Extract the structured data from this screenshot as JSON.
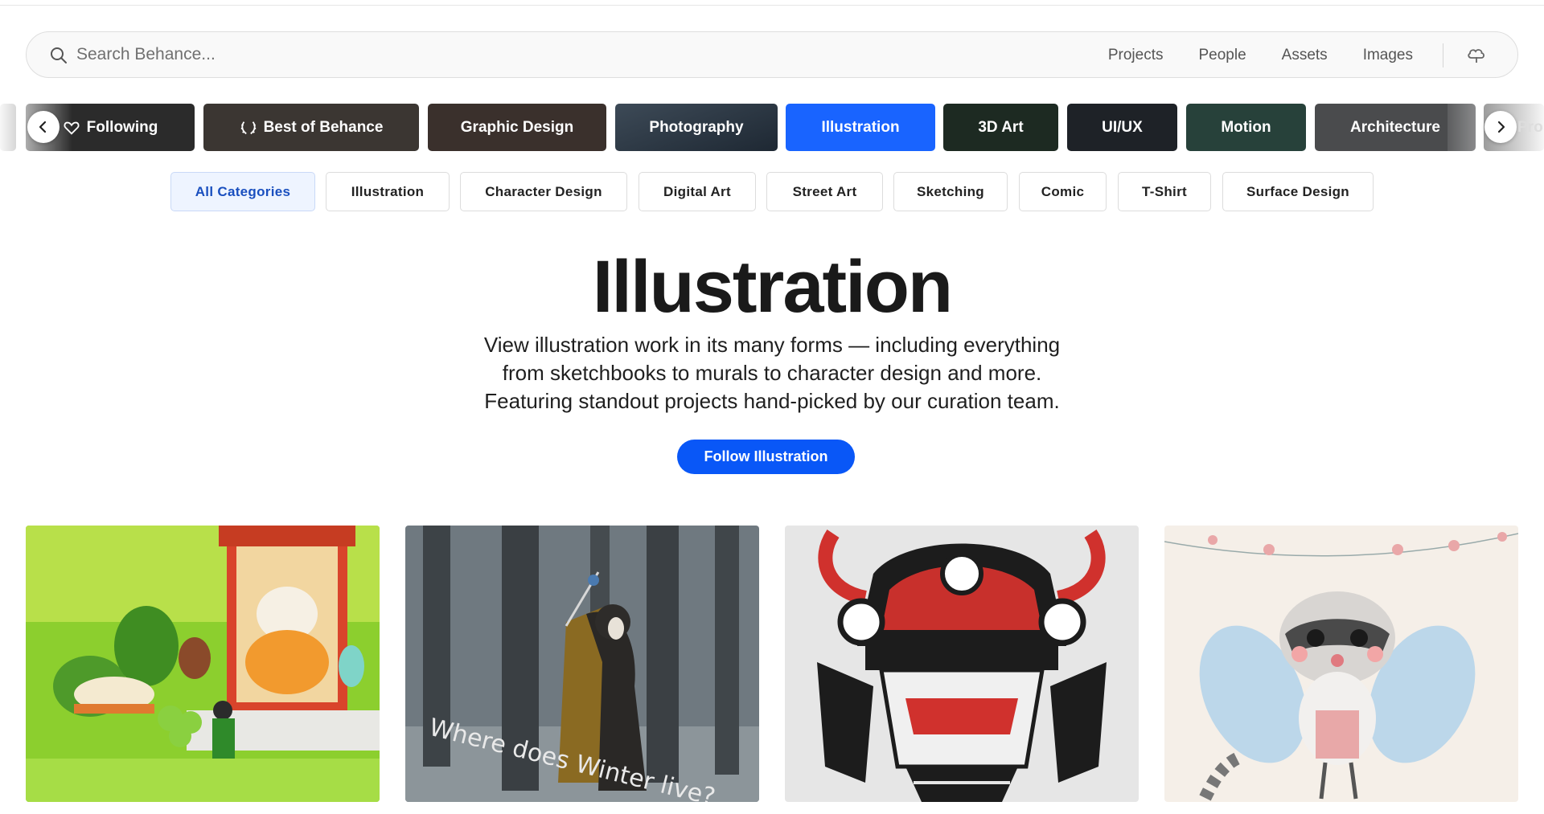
{
  "search": {
    "placeholder": "Search Behance...",
    "links": [
      "Projects",
      "People",
      "Assets",
      "Images"
    ]
  },
  "categories": [
    {
      "label": "Following",
      "icon": "heart-icon",
      "color": "#2e2e2e"
    },
    {
      "label": "Best of Behance",
      "icon": "laurel-icon",
      "color": "#3b3632"
    },
    {
      "label": "Graphic Design",
      "icon": "",
      "color": "#3a302c"
    },
    {
      "label": "Photography",
      "icon": "",
      "color": "#2f3a46"
    },
    {
      "label": "Illustration",
      "icon": "",
      "color": "#1964ff",
      "active": true
    },
    {
      "label": "3D Art",
      "icon": "",
      "color": "#1d2a22"
    },
    {
      "label": "UI/UX",
      "icon": "",
      "color": "#1e2227"
    },
    {
      "label": "Motion",
      "icon": "",
      "color": "#27413a"
    },
    {
      "label": "Architecture",
      "icon": "",
      "color": "#4a4b4d"
    }
  ],
  "category_next_partial": "Pro",
  "subcategories": [
    "All Categories",
    "Illustration",
    "Character Design",
    "Digital Art",
    "Street Art",
    "Sketching",
    "Comic",
    "T-Shirt",
    "Surface Design"
  ],
  "hero": {
    "title": "Illustration",
    "description_lines": [
      "View illustration work in its many forms — including everything",
      "from sketchbooks to murals to character design and more.",
      "Featuring standout projects hand-picked by our curation team."
    ],
    "follow_label": "Follow Illustration"
  },
  "projects": [
    {
      "subject": "cats-temple-illustration"
    },
    {
      "subject": "winter-forest-figure",
      "caption": "Where does Winter live?"
    },
    {
      "subject": "samurai-helmet-ink"
    },
    {
      "subject": "raccoon-fairy-pencil"
    }
  ],
  "colors": {
    "accent": "#1964ff",
    "button": "#0957f7"
  }
}
